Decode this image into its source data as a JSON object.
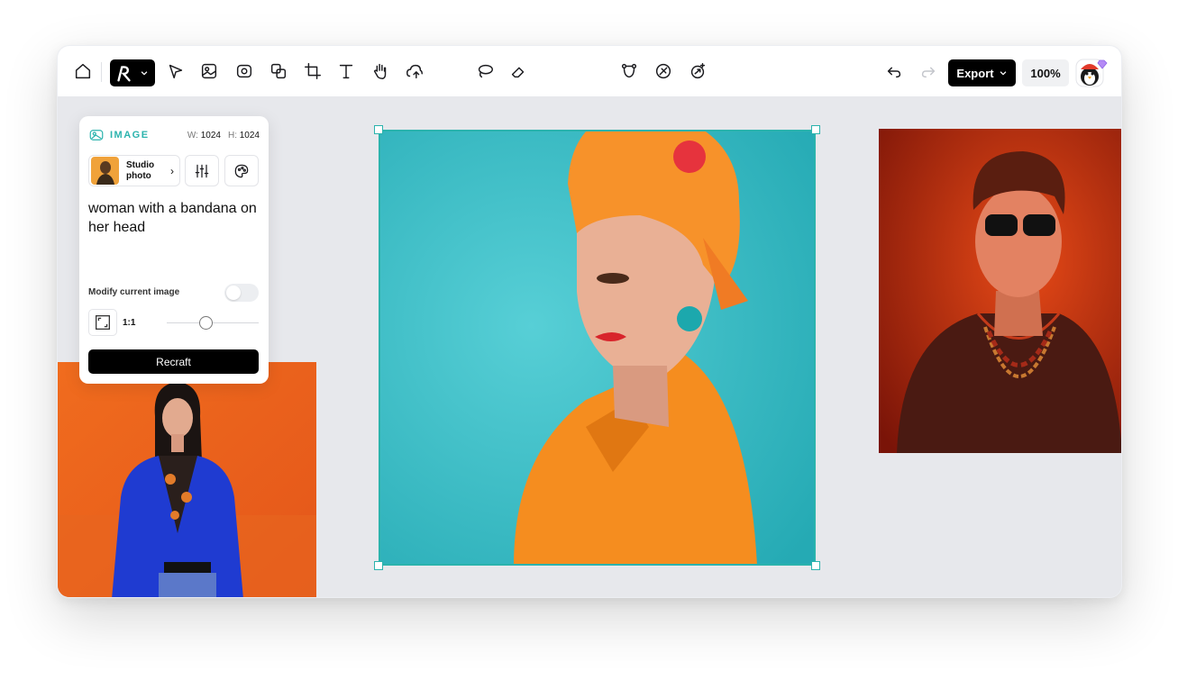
{
  "toolbar": {
    "tools": [
      {
        "name": "home-icon"
      },
      {
        "name": "select-arrow-icon"
      },
      {
        "name": "image-frame-icon"
      },
      {
        "name": "image-generate-icon"
      },
      {
        "name": "layers-icon"
      },
      {
        "name": "crop-frame-icon"
      },
      {
        "name": "text-tool-icon"
      },
      {
        "name": "hand-tool-icon"
      },
      {
        "name": "upload-image-icon"
      },
      {
        "name": "lasso-icon"
      },
      {
        "name": "eraser-icon"
      },
      {
        "name": "vectorize-icon"
      },
      {
        "name": "remove-background-icon"
      },
      {
        "name": "upscale-icon"
      },
      {
        "name": "undo-icon"
      },
      {
        "name": "redo-icon"
      }
    ],
    "export_label": "Export",
    "zoom_level": "100%"
  },
  "panel": {
    "title": "IMAGE",
    "width_label": "W:",
    "width_value": "1024",
    "height_label": "H:",
    "height_value": "1024",
    "style_label": "Studio photo",
    "prompt": "woman with a bandana on her head",
    "modify_label": "Modify current image",
    "modify_enabled": false,
    "ratio_label": "1:1",
    "recraft_label": "Recraft"
  },
  "colors": {
    "accent": "#2bb3ad",
    "canvas_bg": "#e7e8ec",
    "button_dark": "#000000"
  }
}
